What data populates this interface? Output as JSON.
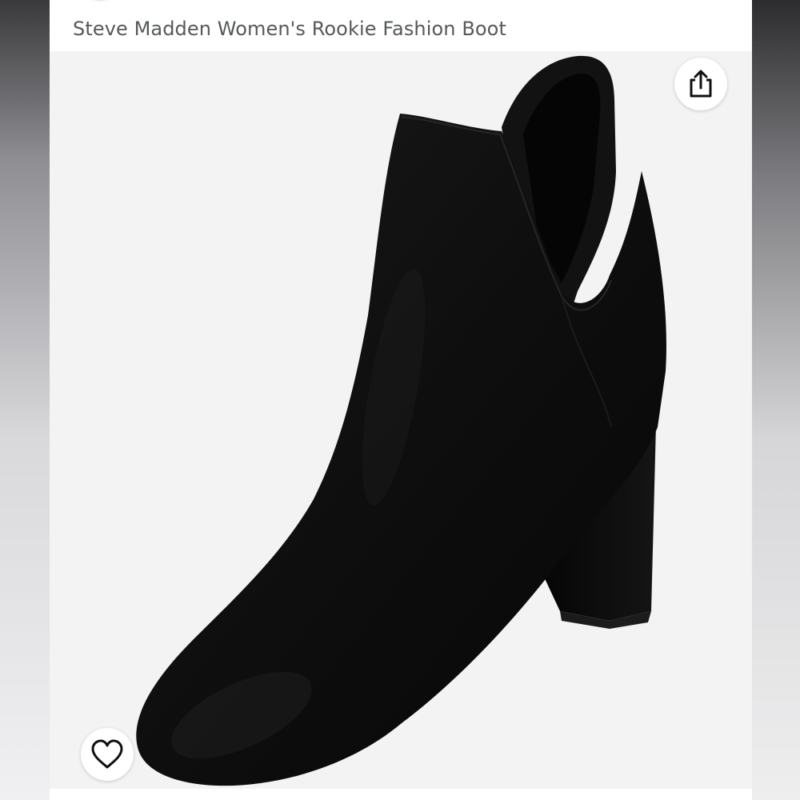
{
  "product": {
    "title": "Steve Madden Women's Rookie Fashion Boot"
  },
  "image": {
    "subject": "black suede ankle boot",
    "background_color": "#f3f3f3",
    "boot_color": "#0d0d0d"
  },
  "actions": {
    "share_icon": "share-icon",
    "wishlist_icon": "heart-outline-icon"
  },
  "colors": {
    "title_text": "#565959",
    "icon_stroke": "#0f1111"
  }
}
